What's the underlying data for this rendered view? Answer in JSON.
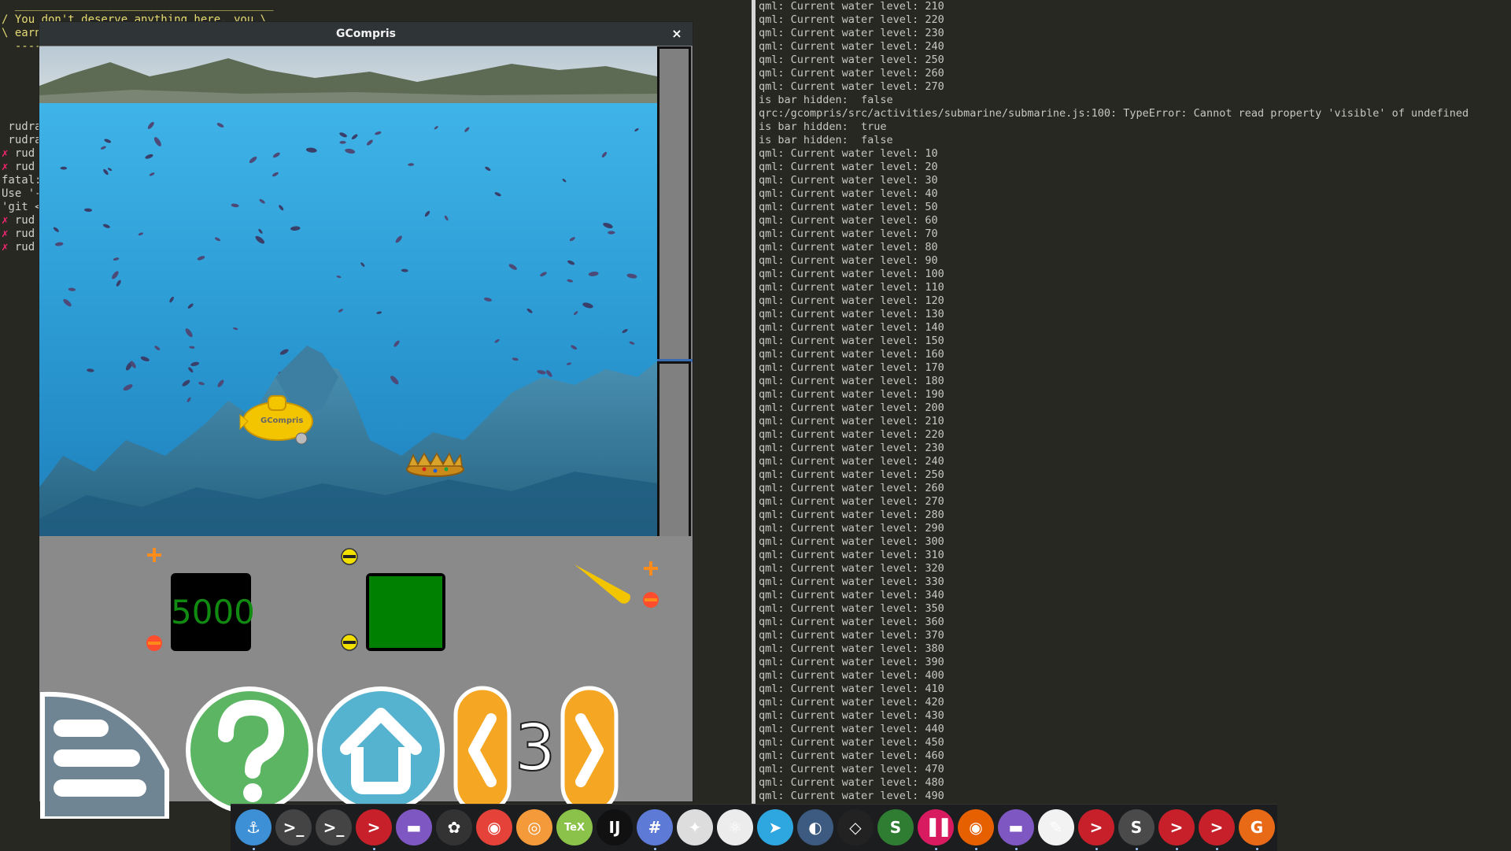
{
  "left_terminal": {
    "fortune_top": "  _______________________________________",
    "fortune_line1": "/ You don't deserve anything here, you \\",
    "fortune_line2": "\\ earn",
    "fortune_line3": "  -----",
    "lines": [
      {
        "text": " rudra",
        "cross": false
      },
      {
        "text": " rudra",
        "cross": false
      },
      {
        "text": " rud",
        "cross": true
      },
      {
        "text": " rud",
        "cross": true
      },
      {
        "text": "fatal:",
        "cross": false
      },
      {
        "text": "Use '-",
        "cross": false
      },
      {
        "text": "'git <",
        "cross": false
      },
      {
        "text": " rud",
        "cross": true
      },
      {
        "text": " rud",
        "cross": true
      },
      {
        "text": " rud",
        "cross": true
      }
    ]
  },
  "right_terminal": {
    "lines": [
      "qml: Current water level: 210",
      "qml: Current water level: 220",
      "qml: Current water level: 230",
      "qml: Current water level: 240",
      "qml: Current water level: 250",
      "qml: Current water level: 260",
      "qml: Current water level: 270",
      "is bar hidden:  false",
      "qrc:/gcompris/src/activities/submarine/submarine.js:100: TypeError: Cannot read property 'visible' of undefined",
      "is bar hidden:  true",
      "is bar hidden:  false",
      "qml: Current water level: 10",
      "qml: Current water level: 20",
      "qml: Current water level: 30",
      "qml: Current water level: 40",
      "qml: Current water level: 50",
      "qml: Current water level: 60",
      "qml: Current water level: 70",
      "qml: Current water level: 80",
      "qml: Current water level: 90",
      "qml: Current water level: 100",
      "qml: Current water level: 110",
      "qml: Current water level: 120",
      "qml: Current water level: 130",
      "qml: Current water level: 140",
      "qml: Current water level: 150",
      "qml: Current water level: 160",
      "qml: Current water level: 170",
      "qml: Current water level: 180",
      "qml: Current water level: 190",
      "qml: Current water level: 200",
      "qml: Current water level: 210",
      "qml: Current water level: 220",
      "qml: Current water level: 230",
      "qml: Current water level: 240",
      "qml: Current water level: 250",
      "qml: Current water level: 260",
      "qml: Current water level: 270",
      "qml: Current water level: 280",
      "qml: Current water level: 290",
      "qml: Current water level: 300",
      "qml: Current water level: 310",
      "qml: Current water level: 320",
      "qml: Current water level: 330",
      "qml: Current water level: 340",
      "qml: Current water level: 350",
      "qml: Current water level: 360",
      "qml: Current water level: 370",
      "qml: Current water level: 380",
      "qml: Current water level: 390",
      "qml: Current water level: 400",
      "qml: Current water level: 410",
      "qml: Current water level: 420",
      "qml: Current water level: 430",
      "qml: Current water level: 440",
      "qml: Current water level: 450",
      "qml: Current water level: 460",
      "qml: Current water level: 470",
      "qml: Current water level: 480",
      "qml: Current water level: 490"
    ]
  },
  "gcompris": {
    "title": "GCompris",
    "close_label": "×",
    "engine_speed": "5000",
    "level": "3",
    "submarine_label": "GCompris"
  },
  "taskbar": {
    "apps": [
      {
        "name": "anchor-icon",
        "glyph": "⚓",
        "color": "#3d8fd6",
        "active": true
      },
      {
        "name": "terminal-icon",
        "glyph": ">_",
        "color": "#444",
        "active": false
      },
      {
        "name": "terminal-icon",
        "glyph": ">_",
        "color": "#444",
        "active": false
      },
      {
        "name": "terminal-red-icon",
        "glyph": ">",
        "color": "#c8202a",
        "active": true
      },
      {
        "name": "files-icon",
        "glyph": "▬",
        "color": "#7e57c2",
        "active": false
      },
      {
        "name": "settings-icon",
        "glyph": "✿",
        "color": "#333",
        "active": false
      },
      {
        "name": "chrome-icon",
        "glyph": "◉",
        "color": "#e5423a",
        "active": false
      },
      {
        "name": "screenshot-icon",
        "glyph": "◎",
        "color": "#f59a3b",
        "active": false
      },
      {
        "name": "tex-icon",
        "glyph": "TeX",
        "color": "#8bc34a",
        "active": false
      },
      {
        "name": "intellij-icon",
        "glyph": "IJ",
        "color": "#111",
        "active": false
      },
      {
        "name": "hashtag-icon",
        "glyph": "#",
        "color": "#5c7ad6",
        "active": true
      },
      {
        "name": "satellite-icon",
        "glyph": "✦",
        "color": "#ddd",
        "active": false
      },
      {
        "name": "atom-icon",
        "glyph": "⚛",
        "color": "#ececec",
        "active": false
      },
      {
        "name": "telegram-icon",
        "glyph": "➤",
        "color": "#2ea6e0",
        "active": false
      },
      {
        "name": "blender-icon",
        "glyph": "◐",
        "color": "#3d5a80",
        "active": false
      },
      {
        "name": "unity-icon",
        "glyph": "◇",
        "color": "#222",
        "active": false
      },
      {
        "name": "slides-icon",
        "glyph": "S",
        "color": "#2e7d32",
        "active": false
      },
      {
        "name": "audio-icon",
        "glyph": "▐▐",
        "color": "#d81b60",
        "active": true
      },
      {
        "name": "firefox-icon",
        "glyph": "◉",
        "color": "#e66000",
        "active": true
      },
      {
        "name": "folder-icon",
        "glyph": "▬",
        "color": "#7e57c2",
        "active": true
      },
      {
        "name": "editor-icon",
        "glyph": "✎",
        "color": "#f2f2f2",
        "active": false
      },
      {
        "name": "terminal-red-icon",
        "glyph": ">",
        "color": "#c8202a",
        "active": true
      },
      {
        "name": "sublime-icon",
        "glyph": "S",
        "color": "#4a4a4a",
        "active": true
      },
      {
        "name": "terminal-red-icon",
        "glyph": ">",
        "color": "#c8202a",
        "active": true
      },
      {
        "name": "terminal-red-icon",
        "glyph": ">",
        "color": "#c8202a",
        "active": true
      },
      {
        "name": "gcompris-icon",
        "glyph": "G",
        "color": "#e86a17",
        "active": true
      }
    ]
  },
  "colors": {
    "sea": "#2f9bd3",
    "panel": "#8a8a8a",
    "help_green": "#5cb562",
    "home_blue": "#55b3cf",
    "nav_orange": "#f5a623",
    "menu_slate": "#6f8594"
  }
}
